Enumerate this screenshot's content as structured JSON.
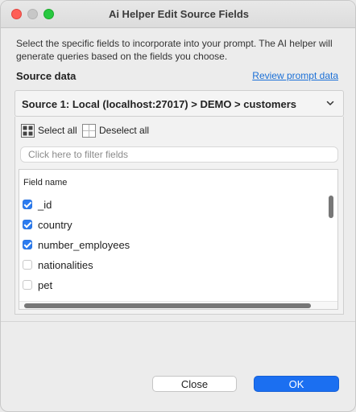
{
  "window": {
    "title": "Ai Helper Edit Source Fields"
  },
  "intro_text": "Select the specific fields to incorporate into your prompt. The AI helper will generate queries based on the fields you choose.",
  "source": {
    "label": "Source data",
    "review_link": "Review prompt data",
    "selected": "Source 1: Local (localhost:27017) > DEMO > customers"
  },
  "selection": {
    "select_all": "Select all",
    "deselect_all": "Deselect all"
  },
  "filter": {
    "placeholder": "Click here to filter fields"
  },
  "table": {
    "header": "Field name",
    "fields": [
      {
        "name": "_id",
        "checked": true
      },
      {
        "name": "country",
        "checked": true
      },
      {
        "name": "number_employees",
        "checked": true
      },
      {
        "name": "nationalities",
        "checked": false
      },
      {
        "name": "pet",
        "checked": false
      }
    ]
  },
  "buttons": {
    "close": "Close",
    "ok": "OK"
  },
  "colors": {
    "accent": "#1b6ff1",
    "link": "#1a6fd6",
    "close_dot": "#fe5f57",
    "max_dot": "#28c840"
  }
}
